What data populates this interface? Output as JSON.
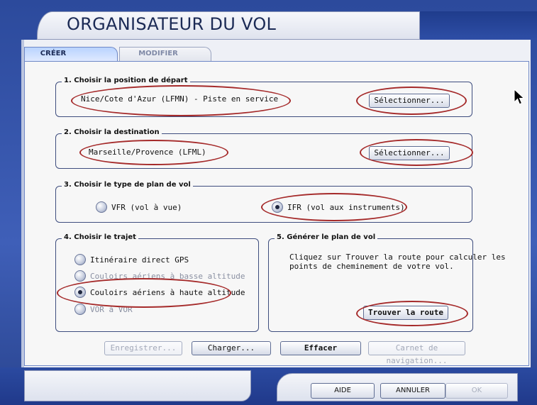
{
  "window": {
    "title": "ORGANISATEUR DU VOL"
  },
  "tabs": [
    {
      "label": "CRÉER",
      "active": true
    },
    {
      "label": "MODIFIER",
      "active": false
    }
  ],
  "section1": {
    "legend": "1. Choisir la position de départ",
    "value": "Nice/Cote d'Azur (LFMN) - Piste en service",
    "button": "Sélectionner..."
  },
  "section2": {
    "legend": "2. Choisir la destination",
    "value": "Marseille/Provence (LFML)",
    "button": "Sélectionner..."
  },
  "section3": {
    "legend": "3. Choisir le type de plan de vol",
    "options": [
      {
        "label": "VFR (vol à vue)",
        "selected": false
      },
      {
        "label": "IFR (vol aux instruments)",
        "selected": true
      }
    ]
  },
  "section4": {
    "legend": "4. Choisir le trajet",
    "options": [
      {
        "label": "Itinéraire direct GPS",
        "selected": false,
        "enabled": true
      },
      {
        "label": "Couloirs aériens à basse altitude",
        "selected": false,
        "enabled": false
      },
      {
        "label": "Couloirs aériens à haute altitude",
        "selected": true,
        "enabled": true
      },
      {
        "label": "VOR à VOR",
        "selected": false,
        "enabled": false
      }
    ]
  },
  "section5": {
    "legend": "5. Générer le plan de vol",
    "text_line1": "Cliquez sur Trouver la route pour calculer les",
    "text_line2": "points de cheminement de votre vol.",
    "button": "Trouver la route"
  },
  "actions": [
    {
      "label": "Enregistrer...",
      "enabled": false
    },
    {
      "label": "Charger...",
      "enabled": true
    },
    {
      "label": "Effacer",
      "enabled": true
    },
    {
      "label": "Carnet de navigation...",
      "enabled": false
    }
  ],
  "dialog_buttons": [
    {
      "label": "AIDE",
      "enabled": true
    },
    {
      "label": "ANNULER",
      "enabled": true
    },
    {
      "label": "OK",
      "enabled": false
    }
  ],
  "colors": {
    "annotation": "#a52a2a",
    "frame_blue": "#2c4a9c",
    "title_text": "#1b2a55"
  }
}
